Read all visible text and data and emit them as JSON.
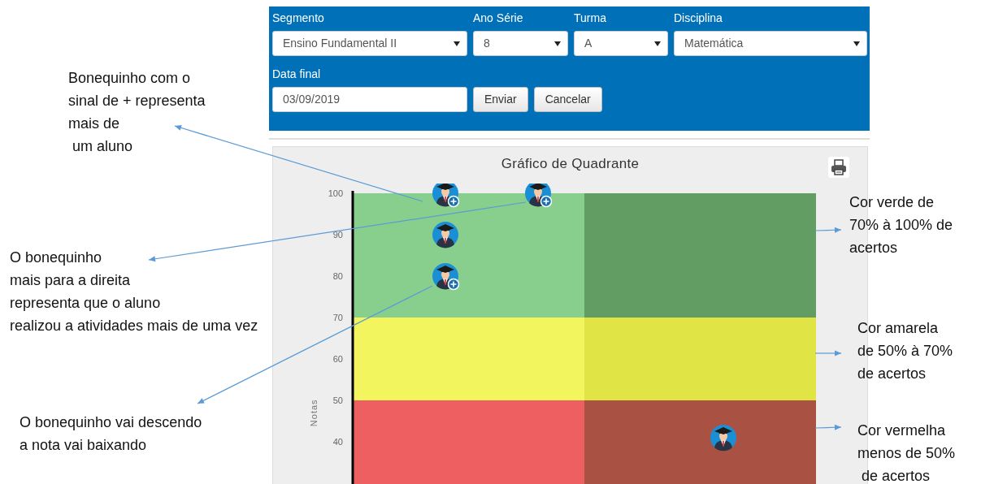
{
  "form": {
    "fields": [
      {
        "label": "Segmento",
        "kind": "select",
        "value": "Ensino Fundamental II"
      },
      {
        "label": "Ano Série",
        "kind": "select",
        "value": "8"
      },
      {
        "label": "Turma",
        "kind": "select",
        "value": "A"
      },
      {
        "label": "Disciplina",
        "kind": "select",
        "value": "Matemática"
      },
      {
        "label": "Data final",
        "kind": "text",
        "value": "03/09/2019"
      }
    ],
    "buttons": [
      "Enviar",
      "Cancelar"
    ]
  },
  "chart": {
    "title": "Gráfico de Quadrante",
    "y_axis_title": "Notas",
    "y_ticks": [
      "100",
      "90",
      "80",
      "70",
      "60",
      "50",
      "40"
    ],
    "quadrants": [
      {
        "color": "#88cf8e"
      },
      {
        "color": "#629d63"
      },
      {
        "color": "#f2f55e"
      },
      {
        "color": "#e0e445"
      },
      {
        "color": "#ee5f61"
      },
      {
        "color": "#a95244"
      }
    ],
    "markers": [
      {
        "kind": "group"
      },
      {
        "kind": "group"
      },
      {
        "kind": "single"
      },
      {
        "kind": "group"
      },
      {
        "kind": "single"
      }
    ]
  },
  "annotations": [
    {
      "text": "Bonequinho com o\nsinal de + representa\nmais de\n um aluno"
    },
    {
      "text": "O bonequinho\nmais para a direita\nrepresenta que o aluno\nrealizou a atividades mais de uma vez"
    },
    {
      "text": "O bonequinho vai descendo\na nota vai baixando"
    },
    {
      "text": "Cor verde de\n70% à 100% de\nacertos"
    },
    {
      "text": "Cor amarela\nde 50% à 70%\nde acertos"
    },
    {
      "text": "Cor vermelha\nmenos de 50%\n de acertos"
    }
  ]
}
